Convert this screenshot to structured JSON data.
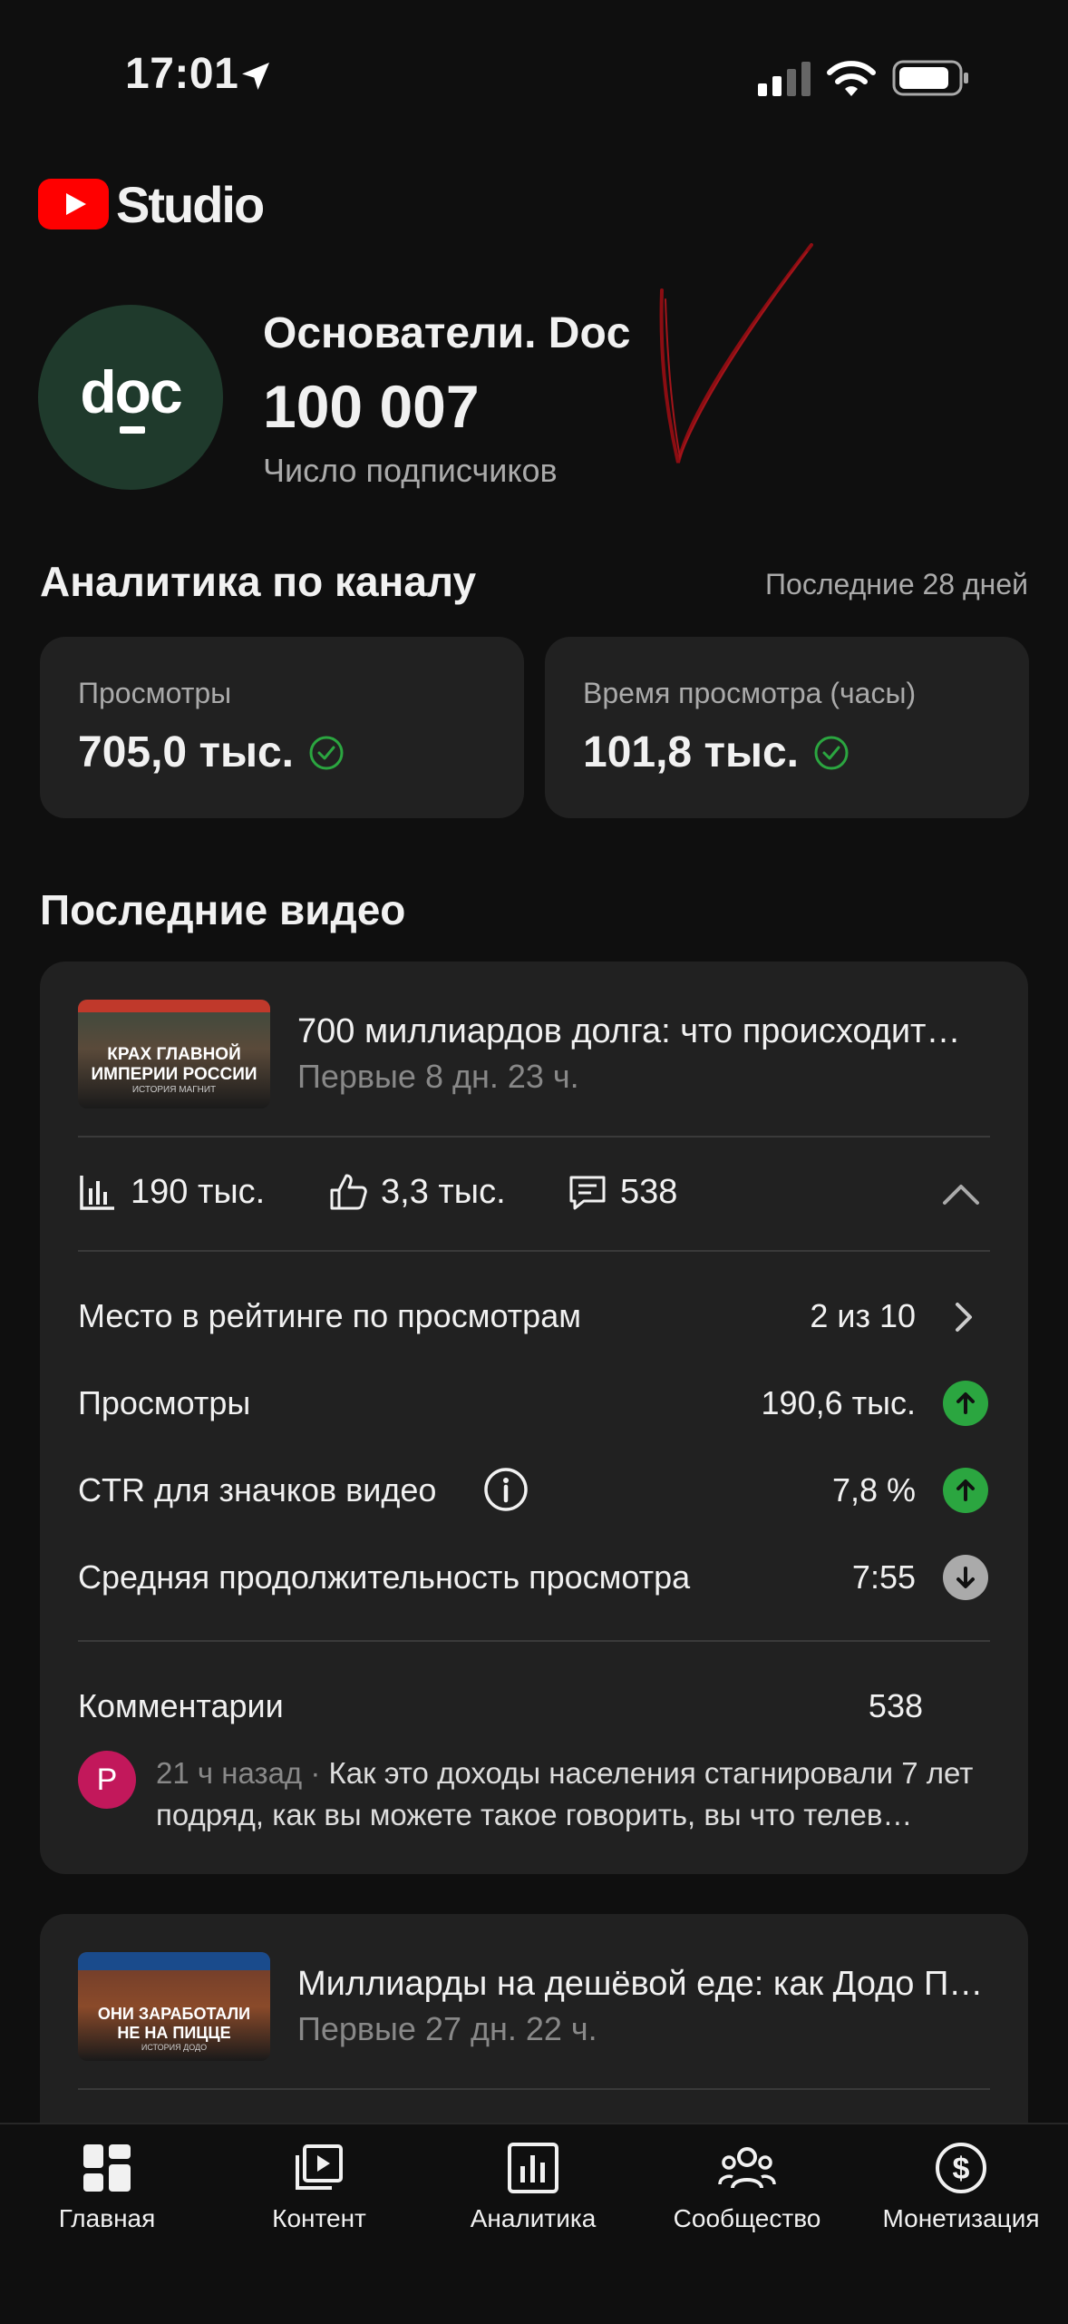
{
  "status_bar": {
    "time": "17:01"
  },
  "app": {
    "logo_text": "Studio"
  },
  "channel": {
    "avatar_text": "doc",
    "name": "Основатели. Doc",
    "subscribers": "100 007",
    "subscribers_label": "Число подписчиков"
  },
  "analytics": {
    "title": "Аналитика по каналу",
    "range": "Последние 28 дней",
    "cards": [
      {
        "label": "Просмотры",
        "value": "705,0 тыс."
      },
      {
        "label": "Время просмотра (часы)",
        "value": "101,8 тыс."
      }
    ]
  },
  "recent": {
    "title": "Последние видео",
    "videos": [
      {
        "title": "700 миллиардов долга: что происходит…",
        "period": "Первые 8 дн. 23 ч.",
        "thumb_text": "КРАХ ГЛАВНОЙ ИМПЕРИИ РОССИИ",
        "thumb_line1": "КРАХ ГЛАВНОЙ",
        "thumb_line2": "ИМПЕРИИ РОССИИ",
        "thumb_caption": "ИСТОРИЯ МАГНИТ",
        "views": "190 тыс.",
        "likes": "3,3 тыс.",
        "comments_count": "538",
        "rows": [
          {
            "label": "Место в рейтинге по просмотрам",
            "value": "2 из 10",
            "indicator": "chevron-right"
          },
          {
            "label": "Просмотры",
            "value": "190,6 тыс.",
            "indicator": "up-green"
          },
          {
            "label": "CTR для значков видео",
            "value": "7,8 %",
            "indicator": "up-green"
          },
          {
            "label": "Средняя продолжительность просмотра",
            "value": "7:55",
            "indicator": "down-gray"
          }
        ],
        "comments_label": "Комментарии",
        "comments_value": "538",
        "comment": {
          "avatar_letter": "P",
          "time": "21 ч назад",
          "text": "Как это доходы населения стагнировали 7 лет подряд, как вы можете такое говорить, вы что телев…"
        }
      },
      {
        "title": "Миллиарды на дешёвой еде: как Додо П…",
        "period": "Первые 27 дн. 22 ч.",
        "thumb_line1": "ОНИ ЗАРАБОТАЛИ",
        "thumb_line2": "НЕ НА ПИЦЦЕ",
        "thumb_caption": "ИСТОРИЯ ДОДО"
      }
    ]
  },
  "colors": {
    "accent_red": "#ff0000",
    "up_green": "#2ba640",
    "down_gray": "#aaaaaa",
    "card": "#212121",
    "bg": "#0f0f0f"
  },
  "nav": [
    {
      "label": "Главная",
      "icon": "dashboard-icon"
    },
    {
      "label": "Контент",
      "icon": "content-icon"
    },
    {
      "label": "Аналитика",
      "icon": "analytics-icon"
    },
    {
      "label": "Сообщество",
      "icon": "community-icon"
    },
    {
      "label": "Монетизация",
      "icon": "monetization-icon"
    }
  ]
}
